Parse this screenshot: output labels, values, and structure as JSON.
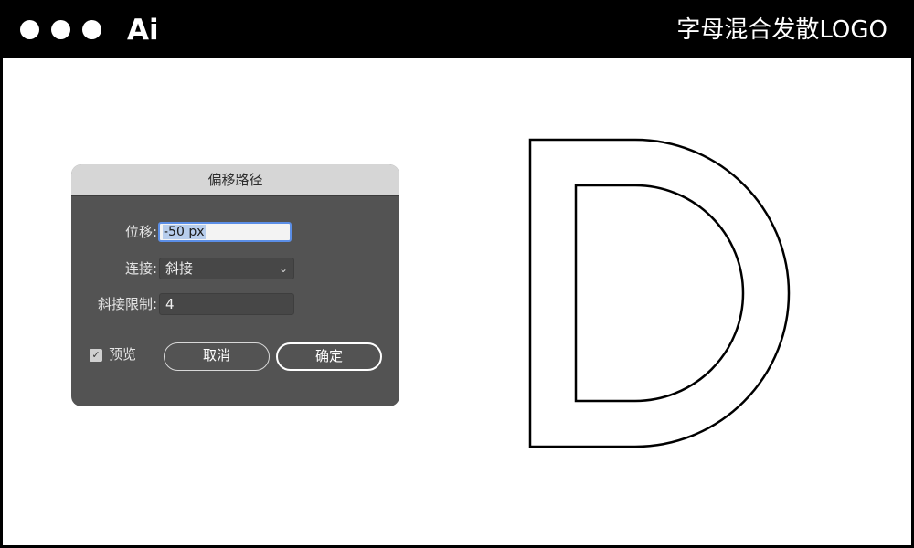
{
  "header": {
    "app_name": "Ai",
    "title": "字母混合发散LOGO"
  },
  "dialog": {
    "title": "偏移路径",
    "offset_label": "位移:",
    "offset_value": "-50 px",
    "join_label": "连接:",
    "join_value": "斜接",
    "miter_label": "斜接限制:",
    "miter_value": "4",
    "preview_label": "预览",
    "preview_checked": true,
    "cancel_label": "取消",
    "ok_label": "确定"
  },
  "artwork": {
    "letter": "D",
    "stroke_color": "#000000"
  }
}
